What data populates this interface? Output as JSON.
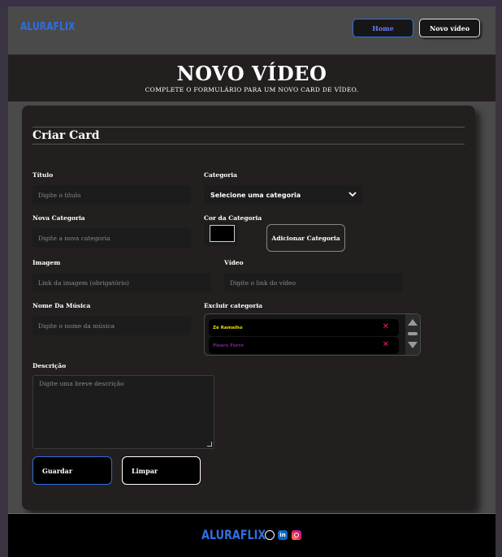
{
  "header": {
    "logo": "ALURAFLIX",
    "home_label": "Home",
    "novo_video_label": "Novo vídeo"
  },
  "hero": {
    "title": "NOVO VÍDEO",
    "subtitle": "COMPLETE O FORMULÁRIO PARA UM NOVO CARD DE VÍDEO."
  },
  "form": {
    "card_title": "Criar Card",
    "titulo": {
      "label": "Título",
      "placeholder": "Digite o título"
    },
    "categoria": {
      "label": "Categoria",
      "selected": "Selecione uma categoria"
    },
    "nova_categoria": {
      "label": "Nova Categoria",
      "placeholder": "Digite a nova categoria"
    },
    "cor_categoria": {
      "label": "Cor da Categoria",
      "value": "#000000"
    },
    "adicionar_categoria_label": "Adicionar Categoria",
    "imagem": {
      "label": "Imagem",
      "placeholder": "Link da imagem (obrigatório)"
    },
    "video": {
      "label": "Vídeo",
      "placeholder": "Digite o link do vídeo"
    },
    "nome_musica": {
      "label": "Nome Da Música",
      "placeholder": "Digite o nome da música"
    },
    "excluir_categoria": {
      "label": "Excluir categoria",
      "items": [
        {
          "name": "Zé Ramalho",
          "color": "#e8e000"
        },
        {
          "name": "Pisero Forró",
          "color": "#7a2a8a"
        }
      ],
      "delete_glyph": "✕"
    },
    "descricao": {
      "label": "Descrição",
      "placeholder": "Digite uma breve descrição"
    },
    "guardar_label": "Guardar",
    "limpar_label": "Limpar"
  },
  "footer": {
    "logo": "ALURAFLIX",
    "icons": [
      "whatsapp-icon",
      "linkedin-icon",
      "instagram-icon"
    ],
    "linkedin_glyph": "in"
  },
  "colors": {
    "accent": "#2f6fe0",
    "card_bg": "#231f1f",
    "page_bg": "#4a4a4a",
    "danger": "#e0245e"
  }
}
